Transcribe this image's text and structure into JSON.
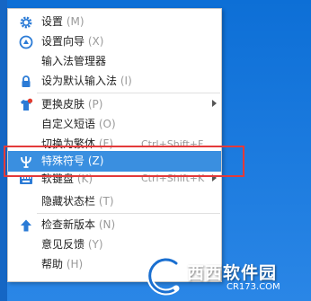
{
  "menu": {
    "items": [
      {
        "label": "设置",
        "key": "(M)",
        "icon": "gear-icon"
      },
      {
        "label": "设置向导",
        "key": "(X)",
        "icon": "wizard-icon"
      },
      {
        "label": "输入法管理器",
        "key": "",
        "icon": ""
      },
      {
        "label": "设为默认输入法",
        "key": "(I)",
        "icon": "lock-icon"
      },
      {
        "label": "更换皮肤",
        "key": "(P)",
        "icon": "shirt-icon"
      },
      {
        "label": "自定义短语",
        "key": "(O)",
        "icon": ""
      },
      {
        "label": "切换为繁体",
        "key": "(F)",
        "icon": "",
        "shortcut": "Ctrl+Shift+F"
      },
      {
        "label": "特殊符号",
        "key": "(Z)",
        "icon": "psi-icon"
      },
      {
        "label": "软键盘",
        "key": "(K)",
        "icon": "keyboard-icon",
        "shortcut": "Ctrl+Shift+K"
      },
      {
        "label": "隐藏状态栏",
        "key": "(T)",
        "icon": ""
      },
      {
        "label": "检查新版本",
        "key": "(N)",
        "icon": "up-arrow-icon"
      },
      {
        "label": "意见反馈",
        "key": "(Y)",
        "icon": ""
      },
      {
        "label": "帮助",
        "key": "(H)",
        "icon": ""
      }
    ],
    "highlighted_index": 7,
    "highlight_color": "#3a8fe0"
  },
  "callout": {
    "color": "#e33a3a"
  },
  "watermark": {
    "brand": "西西软件园",
    "url": "CR173.COM"
  },
  "colors": {
    "desktop": "#1777dc",
    "icon_blue": "#2b7bd6",
    "badge_red": "#e23b2e"
  }
}
